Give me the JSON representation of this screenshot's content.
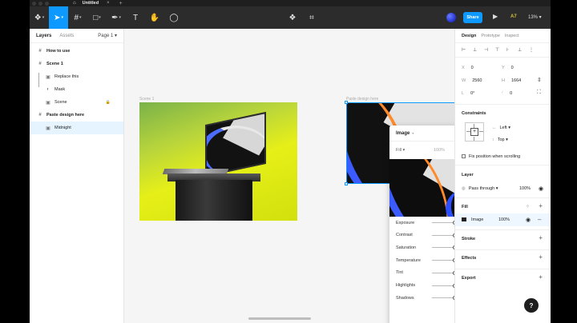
{
  "tab": {
    "title": "Untitled"
  },
  "toolbar": {
    "share_label": "Share",
    "badge": "A7",
    "zoom": "13%"
  },
  "layers_panel": {
    "tabs": [
      "Layers",
      "Assets"
    ],
    "page": "Page 1",
    "items": [
      {
        "label": "How to use",
        "icon": "frame-icon"
      },
      {
        "label": "Scene 1",
        "icon": "frame-icon"
      },
      {
        "label": "Replace this",
        "icon": "image-icon"
      },
      {
        "label": "Mask",
        "icon": "mask-icon"
      },
      {
        "label": "Scene",
        "icon": "image-icon"
      },
      {
        "label": "Paste design here",
        "icon": "frame-icon"
      },
      {
        "label": "Midnight",
        "icon": "image-icon"
      }
    ]
  },
  "canvas": {
    "frame1_label": "Scene 1",
    "frame2_label": "Paste design here"
  },
  "image_popup": {
    "title": "Image",
    "mode": "Fill",
    "percent": "100%",
    "adjustments": [
      {
        "label": "Exposure",
        "value": 0.5
      },
      {
        "label": "Contrast",
        "value": 0.5
      },
      {
        "label": "Saturation",
        "value": 0.5
      },
      {
        "label": "Temperature",
        "value": 0.5
      },
      {
        "label": "Tint",
        "value": 0.5
      },
      {
        "label": "Highlights",
        "value": 0.5
      },
      {
        "label": "Shadows",
        "value": 0.5
      }
    ]
  },
  "design_panel": {
    "tabs": [
      "Design",
      "Prototype",
      "Inspect"
    ],
    "x_label": "X",
    "x": "0",
    "y_label": "Y",
    "y": "0",
    "w_label": "W",
    "w": "2560",
    "h_label": "H",
    "h": "1664",
    "r_label": "L",
    "rotation": "0°",
    "radius": "0",
    "constraints_title": "Constraints",
    "constraint_h": "Left",
    "constraint_v": "Top",
    "fix_position": "Fix position when scrolling",
    "layer_title": "Layer",
    "blend": "Pass through",
    "layer_opacity": "100%",
    "fill_title": "Fill",
    "fill_type": "Image",
    "fill_opacity": "100%",
    "stroke_title": "Stroke",
    "effects_title": "Effects",
    "export_title": "Export"
  },
  "help": "?",
  "colors": {
    "accent": "#0d99ff",
    "toolbar": "#2c2c2c"
  }
}
